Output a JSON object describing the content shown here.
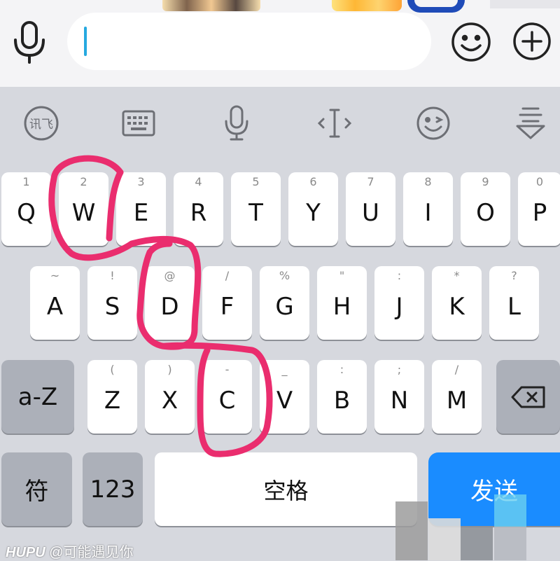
{
  "colors": {
    "annotation": "#ea2d6e",
    "send_key": "#1a8cff",
    "caret": "#26a9e0"
  },
  "input_bar": {
    "icons": [
      "microphone-icon",
      "smiley-icon",
      "plus-icon"
    ],
    "text_value": ""
  },
  "toolbar": {
    "items": [
      {
        "name": "xunfei-logo-icon",
        "label": "讯飞"
      },
      {
        "name": "keyboard-icon"
      },
      {
        "name": "microphone-icon"
      },
      {
        "name": "cursor-move-icon",
        "label": "‹I›"
      },
      {
        "name": "emoji-icon"
      },
      {
        "name": "collapse-keyboard-icon"
      }
    ]
  },
  "keyboard": {
    "row1": [
      {
        "key": "Q",
        "hint": "1"
      },
      {
        "key": "W",
        "hint": "2"
      },
      {
        "key": "E",
        "hint": "3"
      },
      {
        "key": "R",
        "hint": "4"
      },
      {
        "key": "T",
        "hint": "5"
      },
      {
        "key": "Y",
        "hint": "6"
      },
      {
        "key": "U",
        "hint": "7"
      },
      {
        "key": "I",
        "hint": "8"
      },
      {
        "key": "O",
        "hint": "9"
      },
      {
        "key": "P",
        "hint": "0"
      }
    ],
    "row2": [
      {
        "key": "A",
        "hint": "~"
      },
      {
        "key": "S",
        "hint": "!"
      },
      {
        "key": "D",
        "hint": "@"
      },
      {
        "key": "F",
        "hint": "/"
      },
      {
        "key": "G",
        "hint": "%"
      },
      {
        "key": "H",
        "hint": "\""
      },
      {
        "key": "J",
        "hint": ":"
      },
      {
        "key": "K",
        "hint": "*"
      },
      {
        "key": "L",
        "hint": "?"
      }
    ],
    "row3": [
      {
        "key": "Z",
        "hint": "("
      },
      {
        "key": "X",
        "hint": ")"
      },
      {
        "key": "C",
        "hint": "-"
      },
      {
        "key": "V",
        "hint": "_"
      },
      {
        "key": "B",
        "hint": ":"
      },
      {
        "key": "N",
        "hint": ";"
      },
      {
        "key": "M",
        "hint": "/"
      }
    ],
    "case_key": "a-Z",
    "backspace_icon": "backspace-icon",
    "symbol_key": "符",
    "number_key": "123",
    "space_key": "空格",
    "send_key": "发送"
  },
  "watermark": {
    "brand": "HUPU",
    "user": "@可能遇见你"
  }
}
